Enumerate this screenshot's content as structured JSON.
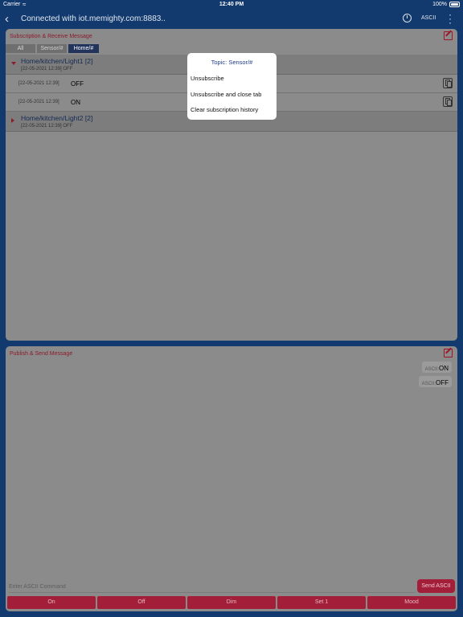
{
  "status_bar": {
    "carrier": "Carrier",
    "wifi_icon": "wifi-icon",
    "time": "12:40 PM",
    "battery": "100%"
  },
  "nav": {
    "title": "Connected with iot.memighty.com:8883..",
    "back_icon": "back-chevron-icon",
    "timer_icon": "timer-icon",
    "encoding": "ASCII",
    "more_icon": "more-vertical-icon"
  },
  "subscription": {
    "title": "Subscription & Receive Message",
    "tabs": [
      {
        "label": "All",
        "active": false
      },
      {
        "label": "Sensor/#",
        "active": false
      },
      {
        "label": "Home/#",
        "active": true
      }
    ],
    "groups": [
      {
        "topic": "Home/kitchen/Light1 [2]",
        "last": "[22-05-2021 12:39] OFF",
        "expanded": true,
        "messages": [
          {
            "timestamp": "[22-05-2021 12:39]",
            "value": "OFF"
          },
          {
            "timestamp": "[22-05-2021 12:39]",
            "value": "ON"
          }
        ]
      },
      {
        "topic": "Home/kitchen/Light2 [2]",
        "last": "[22-05-2021 12:39] OFF",
        "expanded": false
      }
    ]
  },
  "publish": {
    "title": "Publish & Send Message",
    "sent": [
      {
        "prefix": "ASCII:",
        "value": "ON"
      },
      {
        "prefix": "ASCII:",
        "value": "OFF"
      }
    ],
    "input_placeholder": "Enter ASCII Command",
    "send_label": "Send ASCII",
    "quick_buttons": [
      "On",
      "Off",
      "Dim",
      "Set 1",
      "Mood"
    ]
  },
  "popup": {
    "title": "Topic: Sensor/#",
    "items": [
      "Unsubscribe",
      "Unsubscribe and close tab",
      "Clear subscription history"
    ]
  },
  "colors": {
    "background": "#123a6e",
    "accent": "#a31e38",
    "active_tab": "#22345c",
    "overlay_gray": "#8b8b8b"
  }
}
